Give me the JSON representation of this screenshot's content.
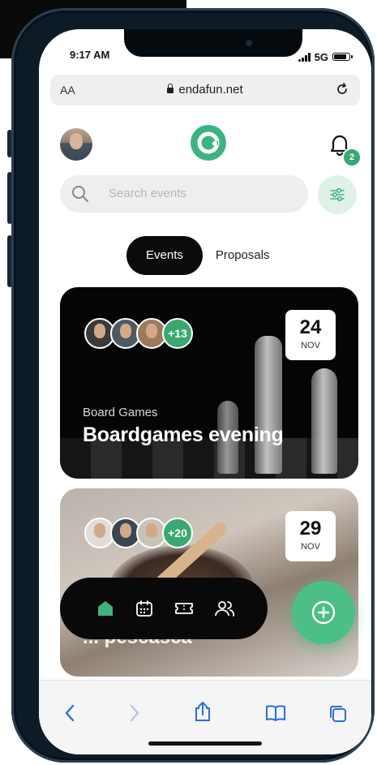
{
  "status": {
    "time": "9:17 AM",
    "network": "5G",
    "battery_level": 0.85
  },
  "browser": {
    "text_size_label": "AA",
    "url": "endafun.net"
  },
  "header": {
    "notification_count": "2"
  },
  "search": {
    "placeholder": "Search events"
  },
  "tabs": [
    {
      "label": "Events",
      "active": true
    },
    {
      "label": "Proposals",
      "active": false
    }
  ],
  "events": [
    {
      "category": "Board Games",
      "title": "Boardgames evening",
      "day": "24",
      "month": "NOV",
      "extra_attendees": "+13"
    },
    {
      "category": "",
      "title": "... pescasca",
      "day": "29",
      "month": "NOV",
      "extra_attendees": "+20"
    }
  ],
  "bottom_nav": {
    "items": [
      "home-icon",
      "calendar-icon",
      "ticket-icon",
      "users-icon"
    ],
    "active": "home-icon"
  },
  "colors": {
    "accent": "#3fb37f",
    "dark": "#0b0b0b",
    "fab": "#4bbf86"
  }
}
